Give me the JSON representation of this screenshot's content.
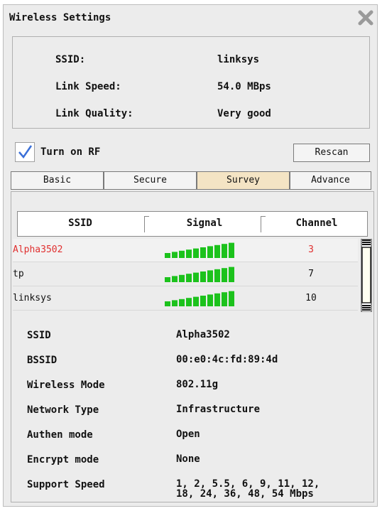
{
  "window": {
    "title": "Wireless Settings"
  },
  "status": [
    {
      "label": "SSID:",
      "value": "linksys"
    },
    {
      "label": "Link Speed:",
      "value": "54.0 MBps"
    },
    {
      "label": "Link Quality:",
      "value": "Very good"
    }
  ],
  "rf": {
    "label": "Turn on RF",
    "checked": true
  },
  "rescan_label": "Rescan",
  "tabs": [
    "Basic",
    "Secure",
    "Survey",
    "Advance"
  ],
  "active_tab": "Survey",
  "columns": [
    "SSID",
    "Signal",
    "Channel"
  ],
  "networks": [
    {
      "ssid": "Alpha3502",
      "channel": "3",
      "signal_bars": 10,
      "selected": true
    },
    {
      "ssid": "tp",
      "channel": "7",
      "signal_bars": 10,
      "selected": false
    },
    {
      "ssid": "linksys",
      "channel": "10",
      "signal_bars": 10,
      "selected": false
    }
  ],
  "details": [
    {
      "label": "SSID",
      "value": "Alpha3502"
    },
    {
      "label": "BSSID",
      "value": "00:e0:4c:fd:89:4d"
    },
    {
      "label": "Wireless Mode",
      "value": "802.11g"
    },
    {
      "label": "Network Type",
      "value": "Infrastructure"
    },
    {
      "label": "Authen mode",
      "value": "Open"
    },
    {
      "label": "Encrypt mode",
      "value": "None"
    },
    {
      "label": "Support Speed",
      "value": "1, 2, 5.5, 6, 9, 11, 12,\n18, 24, 36, 48, 54 Mbps"
    }
  ],
  "colors": {
    "selected_text": "#e03030",
    "signal": "#1cc21c",
    "active_tab": "#f4e4c4"
  }
}
